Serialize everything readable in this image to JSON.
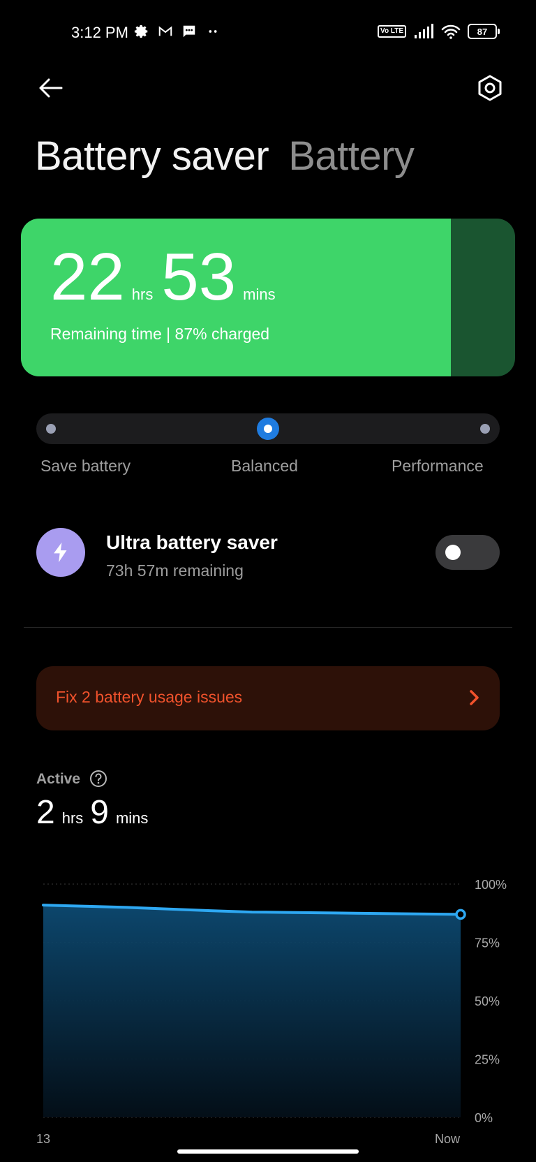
{
  "status_bar": {
    "time": "3:12 PM",
    "left_icons": [
      "gear-icon",
      "gmail-icon",
      "message-icon",
      "more-dots-icon"
    ],
    "volte": "Vo LTE",
    "battery_level": "87"
  },
  "header": {
    "back_icon": "arrow-left-icon",
    "settings_icon": "hexagon-settings-icon",
    "tabs": [
      {
        "label": "Battery saver",
        "active": true
      },
      {
        "label": "Battery",
        "active": false
      }
    ]
  },
  "battery_card": {
    "hours": "22",
    "hours_unit": "hrs",
    "minutes": "53",
    "minutes_unit": "mins",
    "caption": "Remaining time | 87% charged",
    "charge_fraction": 0.87,
    "fill_color": "#3ed569",
    "empty_color": "#1a5530"
  },
  "mode_selector": {
    "options": [
      "Save battery",
      "Balanced",
      "Performance"
    ],
    "selected": "Balanced",
    "accent": "#1f7ce0"
  },
  "ultra_saver": {
    "title": "Ultra battery saver",
    "subtitle": "73h 57m remaining",
    "icon": "lightning-icon",
    "enabled": false
  },
  "issues": {
    "label": "Fix 2 battery usage issues",
    "color": "#f0522c"
  },
  "active": {
    "label": "Active",
    "hours": "2",
    "hours_unit": "hrs",
    "minutes": "9",
    "minutes_unit": "mins"
  },
  "chart_data": {
    "type": "area",
    "x": [
      0,
      1
    ],
    "x_tick_labels": [
      "13",
      "Now"
    ],
    "y_tick_labels": [
      "100%",
      "75%",
      "50%",
      "25%",
      "0%"
    ],
    "ylim": [
      0,
      100
    ],
    "series": [
      {
        "values": [
          91,
          90.5,
          90,
          89.3,
          88.6,
          88,
          87.8,
          87.6,
          87.4,
          87.2,
          87
        ]
      }
    ],
    "grid": true,
    "line_color": "#2ea8f2"
  }
}
